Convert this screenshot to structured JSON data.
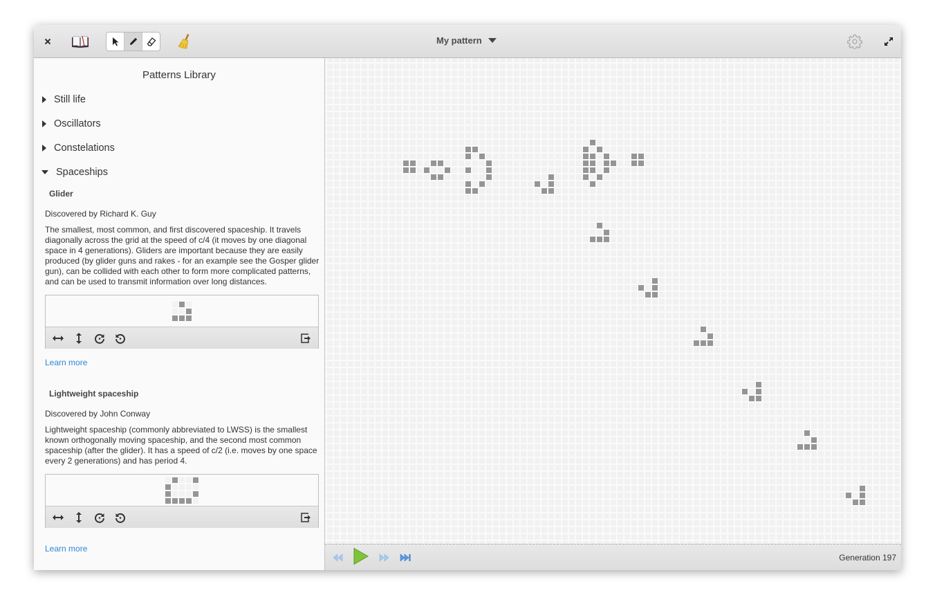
{
  "header": {
    "close_icon": "close-icon",
    "library_icon": "open-book-icon",
    "tools": [
      {
        "name": "select",
        "icon": "pointer-arrow-icon",
        "active": false
      },
      {
        "name": "draw",
        "icon": "pencil-icon",
        "active": true
      },
      {
        "name": "erase",
        "icon": "eraser-icon",
        "active": false
      }
    ],
    "clear_icon": "broom-icon",
    "title": "My pattern",
    "settings_icon": "gear-icon",
    "fullscreen_icon": "fullscreen-icon"
  },
  "sidebar": {
    "title": "Patterns Library",
    "categories": [
      {
        "label": "Still life",
        "expanded": false
      },
      {
        "label": "Oscillators",
        "expanded": false
      },
      {
        "label": "Constelations",
        "expanded": false
      },
      {
        "label": "Spaceships",
        "expanded": true
      }
    ],
    "patterns": [
      {
        "name": "Glider",
        "discovered": "Discovered by Richard K. Guy",
        "description": "The smallest, most common, and first discovered spaceship. It travels diagonally across the grid at the speed of c/4 (it moves by one diagonal space in 4 generations). Gliders are important because they are easily produced (by glider guns and rakes - for an example see the Gosper glider gun), can be collided with each other to form more complicated patterns, and can be used to transmit information over long distances.",
        "cells": [
          [
            0,
            1,
            0
          ],
          [
            0,
            0,
            1
          ],
          [
            1,
            1,
            1
          ]
        ],
        "learn_more": "Learn more"
      },
      {
        "name": "Lightweight spaceship",
        "discovered": "Discovered by John Conway",
        "description": "Lightweight spaceship (commonly abbreviated to LWSS) is the smallest known orthogonally moving spaceship, and the second most common spaceship (after the glider). It has a speed of c/2 (i.e. moves by one space every 2 generations) and has period 4.",
        "cells": [
          [
            0,
            1,
            0,
            0,
            1
          ],
          [
            1,
            0,
            0,
            0,
            0
          ],
          [
            1,
            0,
            0,
            0,
            1
          ],
          [
            1,
            1,
            1,
            1,
            0
          ]
        ],
        "learn_more": "Learn more"
      }
    ],
    "preview_tools": [
      "flip-horizontal-icon",
      "flip-vertical-icon",
      "rotate-clockwise-icon",
      "rotate-counterclockwise-icon",
      "insert-pattern-icon"
    ]
  },
  "board": {
    "live_cells": [
      [
        11,
        15
      ],
      [
        12,
        15
      ],
      [
        11,
        16
      ],
      [
        12,
        16
      ],
      [
        15,
        15
      ],
      [
        16,
        15
      ],
      [
        14,
        16
      ],
      [
        17,
        16
      ],
      [
        15,
        17
      ],
      [
        16,
        17
      ],
      [
        20,
        13
      ],
      [
        21,
        13
      ],
      [
        20,
        14
      ],
      [
        22,
        14
      ],
      [
        23,
        15
      ],
      [
        20,
        16
      ],
      [
        23,
        16
      ],
      [
        23,
        17
      ],
      [
        20,
        18
      ],
      [
        22,
        18
      ],
      [
        20,
        19
      ],
      [
        21,
        19
      ],
      [
        32,
        17
      ],
      [
        30,
        18
      ],
      [
        32,
        18
      ],
      [
        31,
        19
      ],
      [
        32,
        19
      ],
      [
        38,
        12
      ],
      [
        37,
        13
      ],
      [
        39,
        13
      ],
      [
        37,
        14
      ],
      [
        38,
        14
      ],
      [
        40,
        14
      ],
      [
        37,
        15
      ],
      [
        38,
        15
      ],
      [
        40,
        15
      ],
      [
        41,
        15
      ],
      [
        37,
        16
      ],
      [
        38,
        16
      ],
      [
        40,
        16
      ],
      [
        37,
        17
      ],
      [
        39,
        17
      ],
      [
        38,
        18
      ],
      [
        44,
        14
      ],
      [
        45,
        14
      ],
      [
        44,
        15
      ],
      [
        45,
        15
      ],
      [
        39,
        24
      ],
      [
        40,
        25
      ],
      [
        38,
        26
      ],
      [
        39,
        26
      ],
      [
        40,
        26
      ],
      [
        47,
        32
      ],
      [
        45,
        33
      ],
      [
        47,
        33
      ],
      [
        46,
        34
      ],
      [
        47,
        34
      ],
      [
        54,
        39
      ],
      [
        55,
        40
      ],
      [
        53,
        41
      ],
      [
        54,
        41
      ],
      [
        55,
        41
      ],
      [
        62,
        47
      ],
      [
        60,
        48
      ],
      [
        62,
        48
      ],
      [
        61,
        49
      ],
      [
        62,
        49
      ],
      [
        69,
        54
      ],
      [
        70,
        55
      ],
      [
        68,
        56
      ],
      [
        69,
        56
      ],
      [
        70,
        56
      ],
      [
        77,
        62
      ],
      [
        75,
        63
      ],
      [
        77,
        63
      ],
      [
        76,
        64
      ],
      [
        77,
        64
      ]
    ],
    "cell_color": "#959595"
  },
  "playback": {
    "rewind_icon": "rewind-icon",
    "play_icon": "play-icon",
    "step_icon": "step-forward-icon",
    "skip_icon": "skip-to-end-icon",
    "generation": "Generation 197"
  }
}
